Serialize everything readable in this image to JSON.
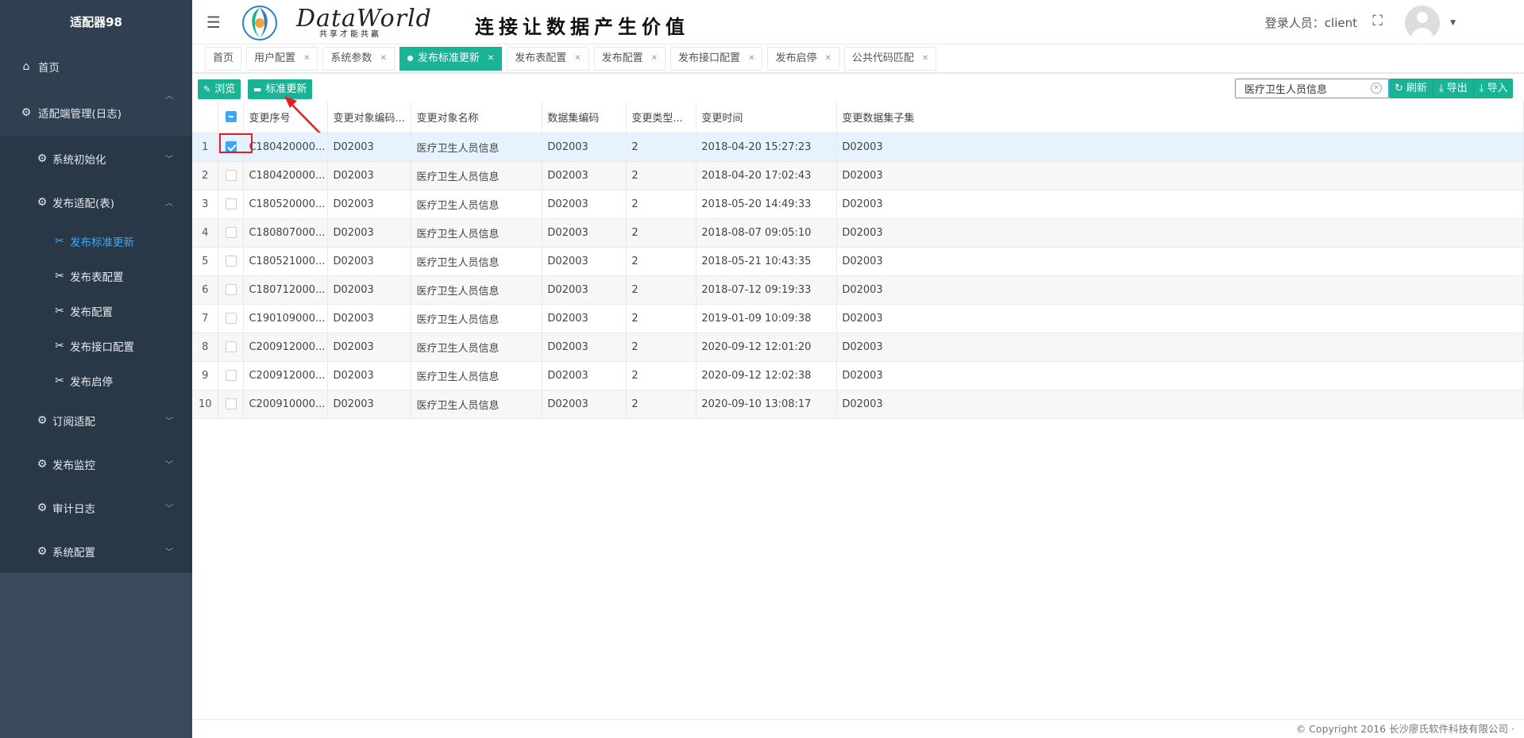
{
  "sidebar": {
    "brand": "适配器98",
    "home": "首页",
    "group": "适配端管理(日志)",
    "sys_init": "系统初始化",
    "publish_group": "发布适配(表)",
    "leaves": [
      {
        "label": "发布标准更新"
      },
      {
        "label": "发布表配置"
      },
      {
        "label": "发布配置"
      },
      {
        "label": "发布接口配置"
      },
      {
        "label": "发布启停"
      }
    ],
    "subs": [
      {
        "label": "订阅适配"
      },
      {
        "label": "发布监控"
      },
      {
        "label": "审计日志"
      },
      {
        "label": "系统配置"
      }
    ]
  },
  "header": {
    "brand_name": "DataWorld",
    "brand_sub": "共享才能共赢",
    "slogan": "连接让数据产生价值",
    "login_user": "登录人员：client"
  },
  "tabs": [
    {
      "label": "首页",
      "closable": false
    },
    {
      "label": "用户配置",
      "closable": true
    },
    {
      "label": "系统参数",
      "closable": true
    },
    {
      "label": "发布标准更新",
      "closable": true,
      "active": true
    },
    {
      "label": "发布表配置",
      "closable": true
    },
    {
      "label": "发布配置",
      "closable": true
    },
    {
      "label": "发布接口配置",
      "closable": true
    },
    {
      "label": "发布启停",
      "closable": true
    },
    {
      "label": "公共代码匹配",
      "closable": true
    }
  ],
  "toolbar": {
    "browse": "浏览",
    "std_update": "标准更新",
    "search_value": "医疗卫生人员信息",
    "refresh": "刷新",
    "export": "导出",
    "import": "导入"
  },
  "table": {
    "columns": [
      "变更序号",
      "变更对象编码...",
      "变更对象名称",
      "数据集编码",
      "变更类型...",
      "变更时间",
      "变更数据集子集"
    ],
    "rows": [
      {
        "n": "1",
        "c": [
          "C180420000...",
          "D02003",
          "医疗卫生人员信息",
          "D02003",
          "2",
          "2018-04-20 15:27:23",
          "D02003"
        ],
        "checked": true
      },
      {
        "n": "2",
        "c": [
          "C180420000...",
          "D02003",
          "医疗卫生人员信息",
          "D02003",
          "2",
          "2018-04-20 17:02:43",
          "D02003"
        ]
      },
      {
        "n": "3",
        "c": [
          "C180520000...",
          "D02003",
          "医疗卫生人员信息",
          "D02003",
          "2",
          "2018-05-20 14:49:33",
          "D02003"
        ]
      },
      {
        "n": "4",
        "c": [
          "C180807000...",
          "D02003",
          "医疗卫生人员信息",
          "D02003",
          "2",
          "2018-08-07 09:05:10",
          "D02003"
        ]
      },
      {
        "n": "5",
        "c": [
          "C180521000...",
          "D02003",
          "医疗卫生人员信息",
          "D02003",
          "2",
          "2018-05-21 10:43:35",
          "D02003"
        ]
      },
      {
        "n": "6",
        "c": [
          "C180712000...",
          "D02003",
          "医疗卫生人员信息",
          "D02003",
          "2",
          "2018-07-12 09:19:33",
          "D02003"
        ]
      },
      {
        "n": "7",
        "c": [
          "C190109000...",
          "D02003",
          "医疗卫生人员信息",
          "D02003",
          "2",
          "2019-01-09 10:09:38",
          "D02003"
        ]
      },
      {
        "n": "8",
        "c": [
          "C200912000...",
          "D02003",
          "医疗卫生人员信息",
          "D02003",
          "2",
          "2020-09-12 12:01:20",
          "D02003"
        ]
      },
      {
        "n": "9",
        "c": [
          "C200912000...",
          "D02003",
          "医疗卫生人员信息",
          "D02003",
          "2",
          "2020-09-12 12:02:38",
          "D02003"
        ]
      },
      {
        "n": "10",
        "c": [
          "C200910000...",
          "D02003",
          "医疗卫生人员信息",
          "D02003",
          "2",
          "2020-09-10 13:08:17",
          "D02003"
        ]
      }
    ]
  },
  "footer": {
    "copyright": "© Copyright 2016 长沙廖氏软件科技有限公司 ·"
  },
  "colors": {
    "sidebar_bg": "#2f4050",
    "accent_green": "#1ab394",
    "active_blue": "#3ea7f5",
    "highlight_red": "#e02020"
  }
}
